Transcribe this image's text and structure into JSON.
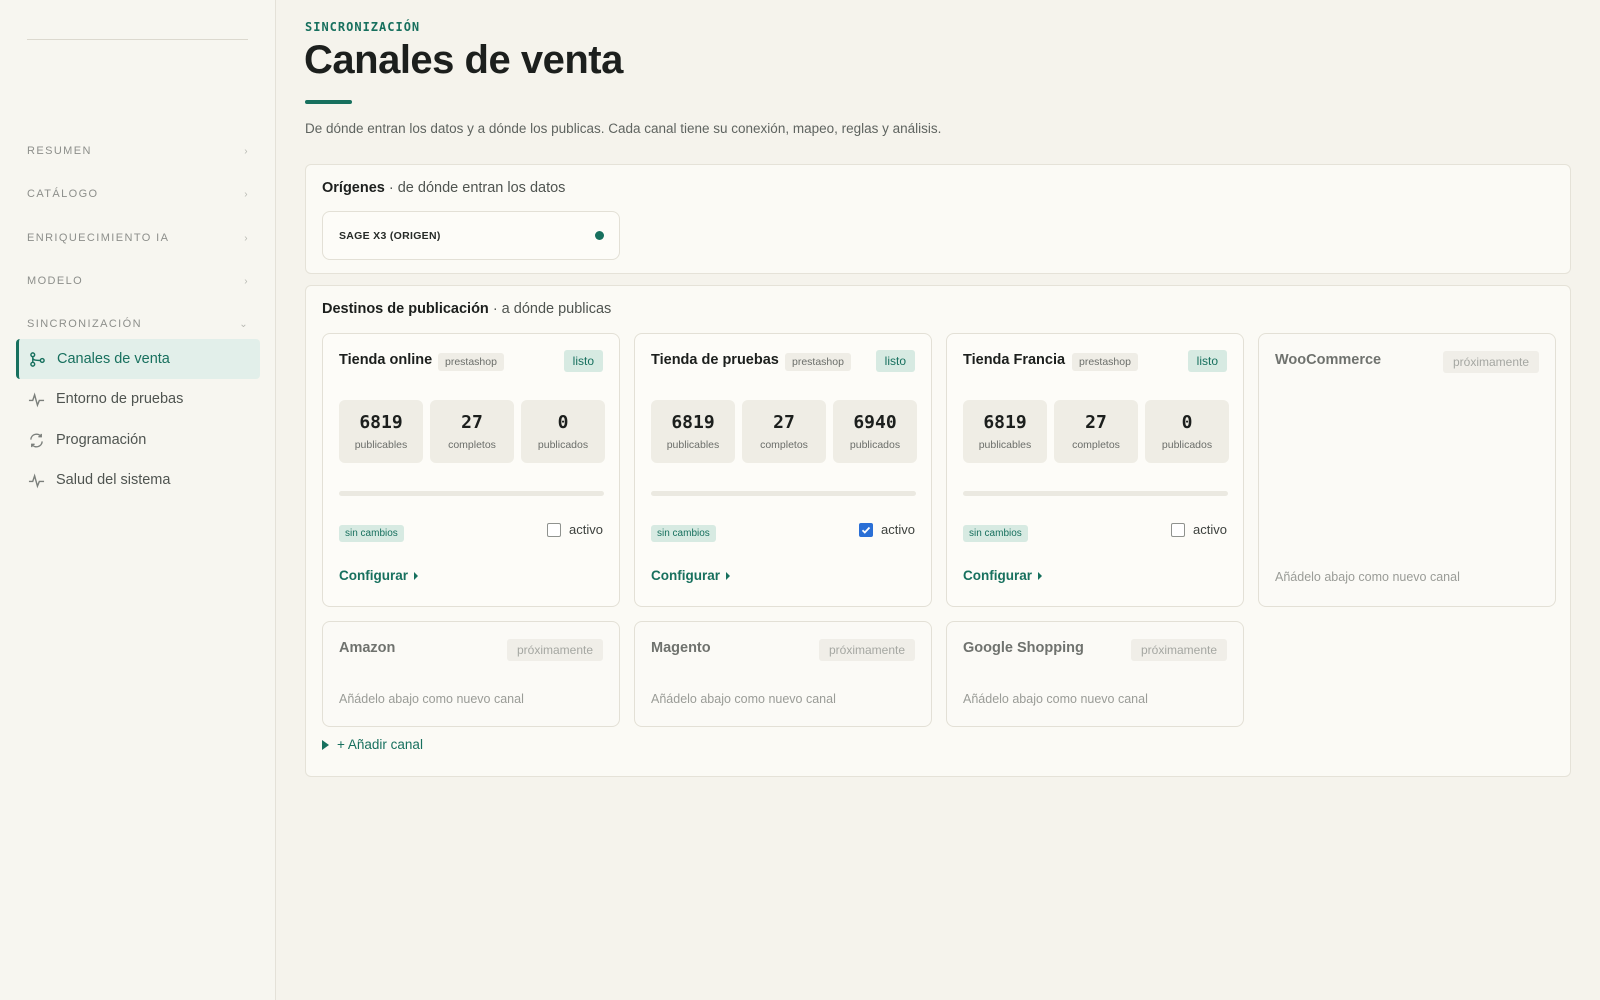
{
  "sidebar": {
    "sections": [
      {
        "label": "RESUMEN",
        "chevron": "›"
      },
      {
        "label": "CATÁLOGO",
        "chevron": "›"
      },
      {
        "label": "ENRIQUECIMIENTO IA",
        "chevron": "›"
      },
      {
        "label": "MODELO",
        "chevron": "›"
      },
      {
        "label": "SINCRONIZACIÓN",
        "chevron": "⌄"
      }
    ],
    "items": [
      {
        "label": "Canales de venta",
        "icon": "branch-icon",
        "active": true
      },
      {
        "label": "Entorno de pruebas",
        "icon": "pulse-icon",
        "active": false
      },
      {
        "label": "Programación",
        "icon": "refresh-icon",
        "active": false
      },
      {
        "label": "Salud del sistema",
        "icon": "pulse-icon",
        "active": false
      }
    ]
  },
  "header": {
    "eyebrow": "SINCRONIZACIÓN",
    "title": "Canales de venta",
    "subtitle": "De dónde entran los datos y a dónde los publicas. Cada canal tiene su conexión, mapeo, reglas y análisis."
  },
  "origins": {
    "title": "Orígenes",
    "subtitle": "· de dónde entran los datos",
    "items": [
      {
        "label": "SAGE X3 (ORIGEN)",
        "status_color": "#17705e"
      }
    ]
  },
  "destinations": {
    "title": "Destinos de publicación",
    "subtitle": "· a dónde publicas",
    "cards": [
      {
        "name": "Tienda online",
        "platform": "prestashop",
        "status": "listo",
        "stats": [
          {
            "value": "6819",
            "label": "publicables"
          },
          {
            "value": "27",
            "label": "completos"
          },
          {
            "value": "0",
            "label": "publicados"
          }
        ],
        "progress": 0,
        "badge": "sin cambios",
        "active_label": "activo",
        "active": false,
        "configure": "Configurar"
      },
      {
        "name": "Tienda de pruebas",
        "platform": "prestashop",
        "status": "listo",
        "stats": [
          {
            "value": "6819",
            "label": "publicables"
          },
          {
            "value": "27",
            "label": "completos"
          },
          {
            "value": "6940",
            "label": "publicados"
          }
        ],
        "progress": 0,
        "badge": "sin cambios",
        "active_label": "activo",
        "active": true,
        "configure": "Configurar"
      },
      {
        "name": "Tienda Francia",
        "platform": "prestashop",
        "status": "listo",
        "stats": [
          {
            "value": "6819",
            "label": "publicables"
          },
          {
            "value": "27",
            "label": "completos"
          },
          {
            "value": "0",
            "label": "publicados"
          }
        ],
        "progress": 0,
        "badge": "sin cambios",
        "active_label": "activo",
        "active": false,
        "configure": "Configurar"
      }
    ],
    "coming_soon": [
      {
        "name": "WooCommerce",
        "tag": "próximamente",
        "hint": "Añádelo abajo como nuevo canal"
      },
      {
        "name": "Amazon",
        "tag": "próximamente",
        "hint": "Añádelo abajo como nuevo canal"
      },
      {
        "name": "Magento",
        "tag": "próximamente",
        "hint": "Añádelo abajo como nuevo canal"
      },
      {
        "name": "Google Shopping",
        "tag": "próximamente",
        "hint": "Añádelo abajo como nuevo canal"
      }
    ],
    "add_channel": "+ Añadir canal"
  },
  "colors": {
    "accent": "#17705e",
    "checkbox": "#2a6fd6",
    "background": "#f5f3ec"
  }
}
